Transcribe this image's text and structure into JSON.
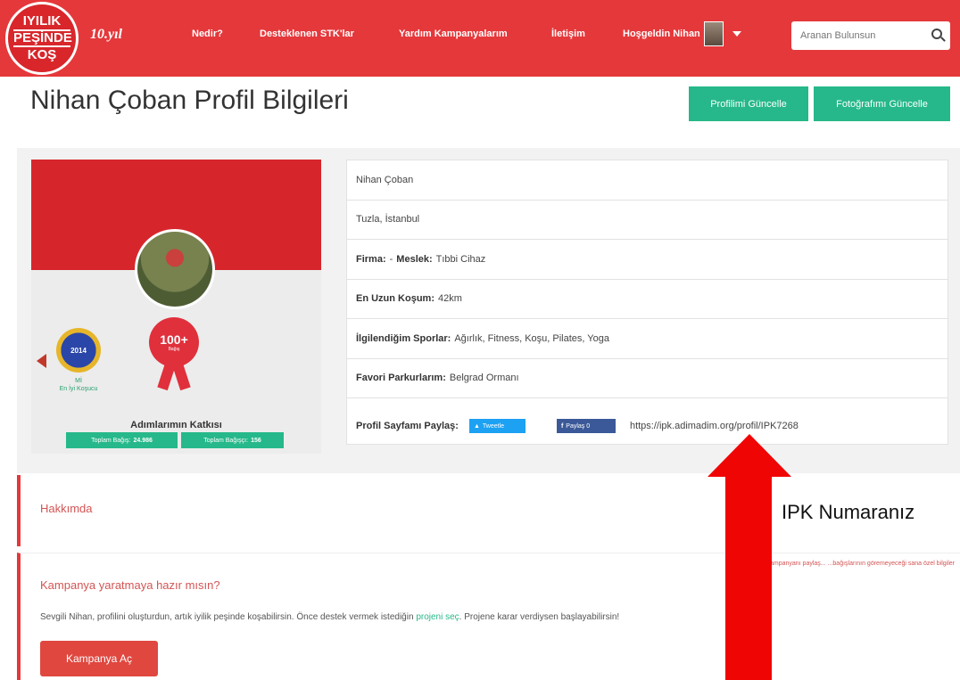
{
  "navbar": {
    "logo_lines": [
      "IYILIK",
      "PEŞİNDE",
      "KOŞ"
    ],
    "years": "10.yıl",
    "links": [
      "Nedir?",
      "Desteklenen STK'lar",
      "Yardım Kampanyalarım",
      "İletişim"
    ],
    "user_greeting": "Hoşgeldin Nihan",
    "search_placeholder": "Aranan Bulunsun"
  },
  "header": {
    "title": "Nihan Çoban Profil Bilgileri",
    "update_profile": "Profilimi Güncelle",
    "update_photo": "Fotoğrafımı Güncelle"
  },
  "badges": {
    "badge1_year": "2014",
    "badge1_caption_1": "Mİ",
    "badge1_caption_2": "En İyi Koşucu",
    "badge2_value": "100+",
    "badge2_sub": "Bağış"
  },
  "steps": {
    "title": "Adımlarımın Katkısı",
    "total_donation_label": "Toplam Bağış:",
    "total_donation_value": "24.986",
    "total_donors_label": "Toplam Bağışçı:",
    "total_donors_value": "156"
  },
  "profile": {
    "name": "Nihan Çoban",
    "location": "Tuzla, İstanbul",
    "firma_label": "Firma:",
    "firma_value": "-",
    "meslek_label": "Meslek:",
    "meslek_value": "Tıbbi Cihaz",
    "longest_run_label": "En Uzun Koşum:",
    "longest_run_value": "42km",
    "sports_label": "İlgilendiğim Sporlar:",
    "sports_value": "Ağırlık, Fitness, Koşu, Pilates, Yoga",
    "courses_label": "Favori Parkurlarım:",
    "courses_value": "Belgrad Ormanı",
    "share_label": "Profil Sayfamı Paylaş:",
    "tweet": "Tweetle",
    "facebook": "Paylaş 0",
    "url": "https://ipk.adimadim.org/profil/IPK7268"
  },
  "about": {
    "title": "Hakkımda"
  },
  "annotation": "IPK Numaranız",
  "campaign": {
    "note": "Kampanyanı paylaş... ...bağışlarının göremeyeceği sana özel bilgiler",
    "title": "Kampanya yaratmaya hazır mısın?",
    "text_before": "Sevgili Nihan, profilini oluşturdun, artık iyilik peşinde koşabilirsin. Önce destek vermek istediğin ",
    "link": "projeni seç",
    "text_after": ". Projene karar verdiysen başlayabilirsin!",
    "button": "Kampanya Aç"
  },
  "colors": {
    "brand_red": "#e5383b",
    "accent_green": "#26b88a",
    "arrow_red": "#f00505"
  }
}
